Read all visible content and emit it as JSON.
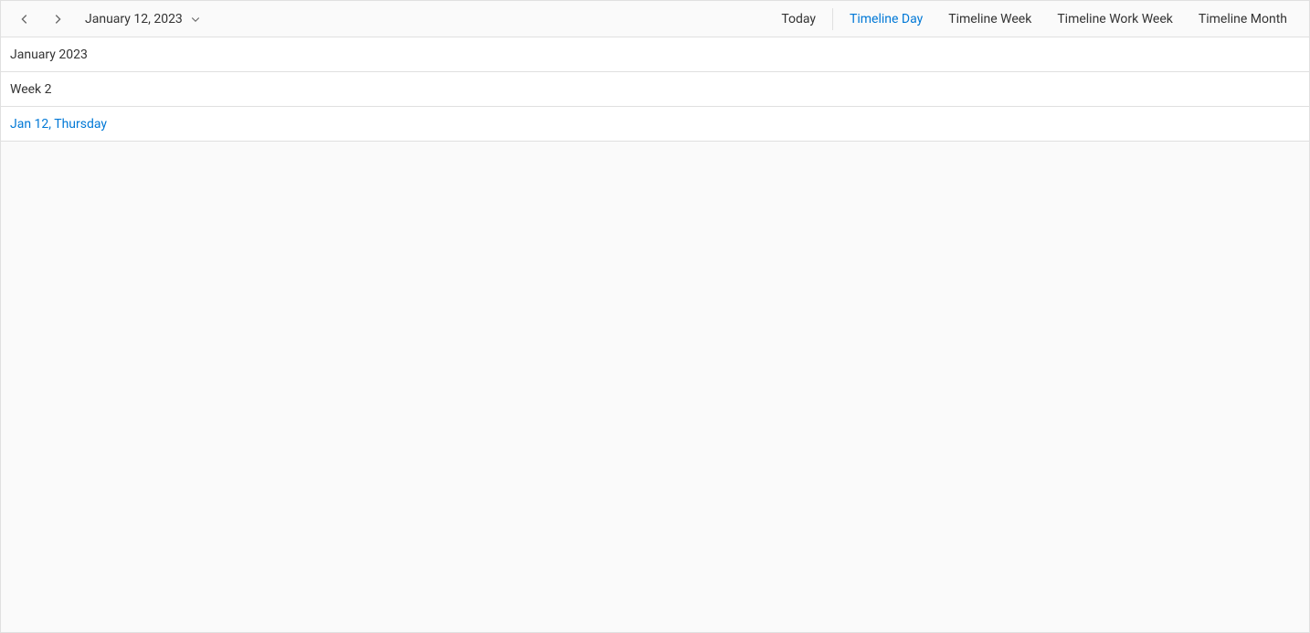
{
  "toolbar": {
    "date_range_label": "January 12, 2023",
    "today_label": "Today",
    "views": {
      "timeline_day": "Timeline Day",
      "timeline_week": "Timeline Week",
      "timeline_work_week": "Timeline Work Week",
      "timeline_month": "Timeline Month"
    },
    "active_view": "timeline_day"
  },
  "headers": {
    "month": "January 2023",
    "week": "Week 2",
    "day": "Jan 12, Thursday"
  }
}
